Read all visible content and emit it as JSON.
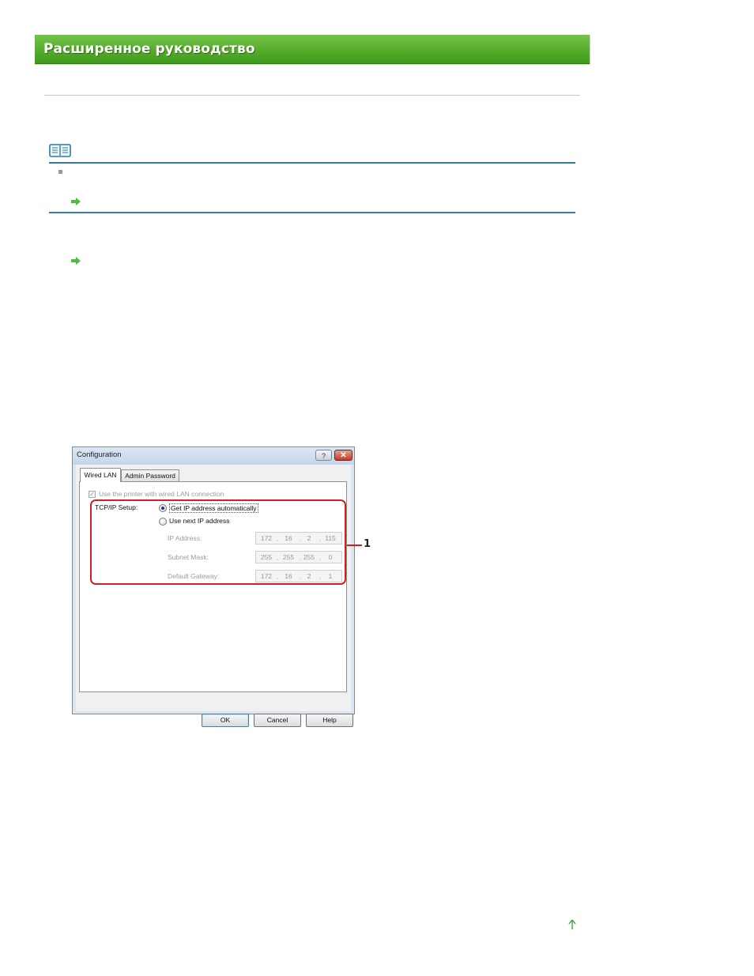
{
  "banner": {
    "title": "Расширенное руководство"
  },
  "colors": {
    "banner_green": "#55ad2a",
    "note_rule": "#2e7fa0",
    "link_arrow": "#54b848",
    "callout_red": "#d21f1f"
  },
  "icons": {
    "note": "book-icon",
    "link1": "green-arrow-icon",
    "link2": "green-arrow-icon",
    "page_top": "arrow-up-icon"
  },
  "dialog": {
    "title": "Configuration",
    "titlebar_help": "?",
    "titlebar_close": "✕",
    "tabs": [
      {
        "label": "Wired LAN",
        "active": true
      },
      {
        "label": "Admin Password",
        "active": false
      }
    ],
    "use_wired_checkbox_label": "Use the printer with wired LAN connection",
    "tcpip_label": "TCP/IP Setup:",
    "radio_auto_label": "Get IP address automatically",
    "radio_manual_label": "Use next IP address",
    "fields": [
      {
        "label": "IP Address:",
        "octets": [
          "172",
          "16",
          "2",
          "115"
        ]
      },
      {
        "label": "Subnet Mask:",
        "octets": [
          "255",
          "255",
          "255",
          "0"
        ]
      },
      {
        "label": "Default Gateway:",
        "octets": [
          "172",
          "16",
          "2",
          "1"
        ]
      }
    ],
    "buttons": {
      "ok": "OK",
      "cancel": "Cancel",
      "help": "Help"
    }
  },
  "callout": {
    "number": "1"
  }
}
